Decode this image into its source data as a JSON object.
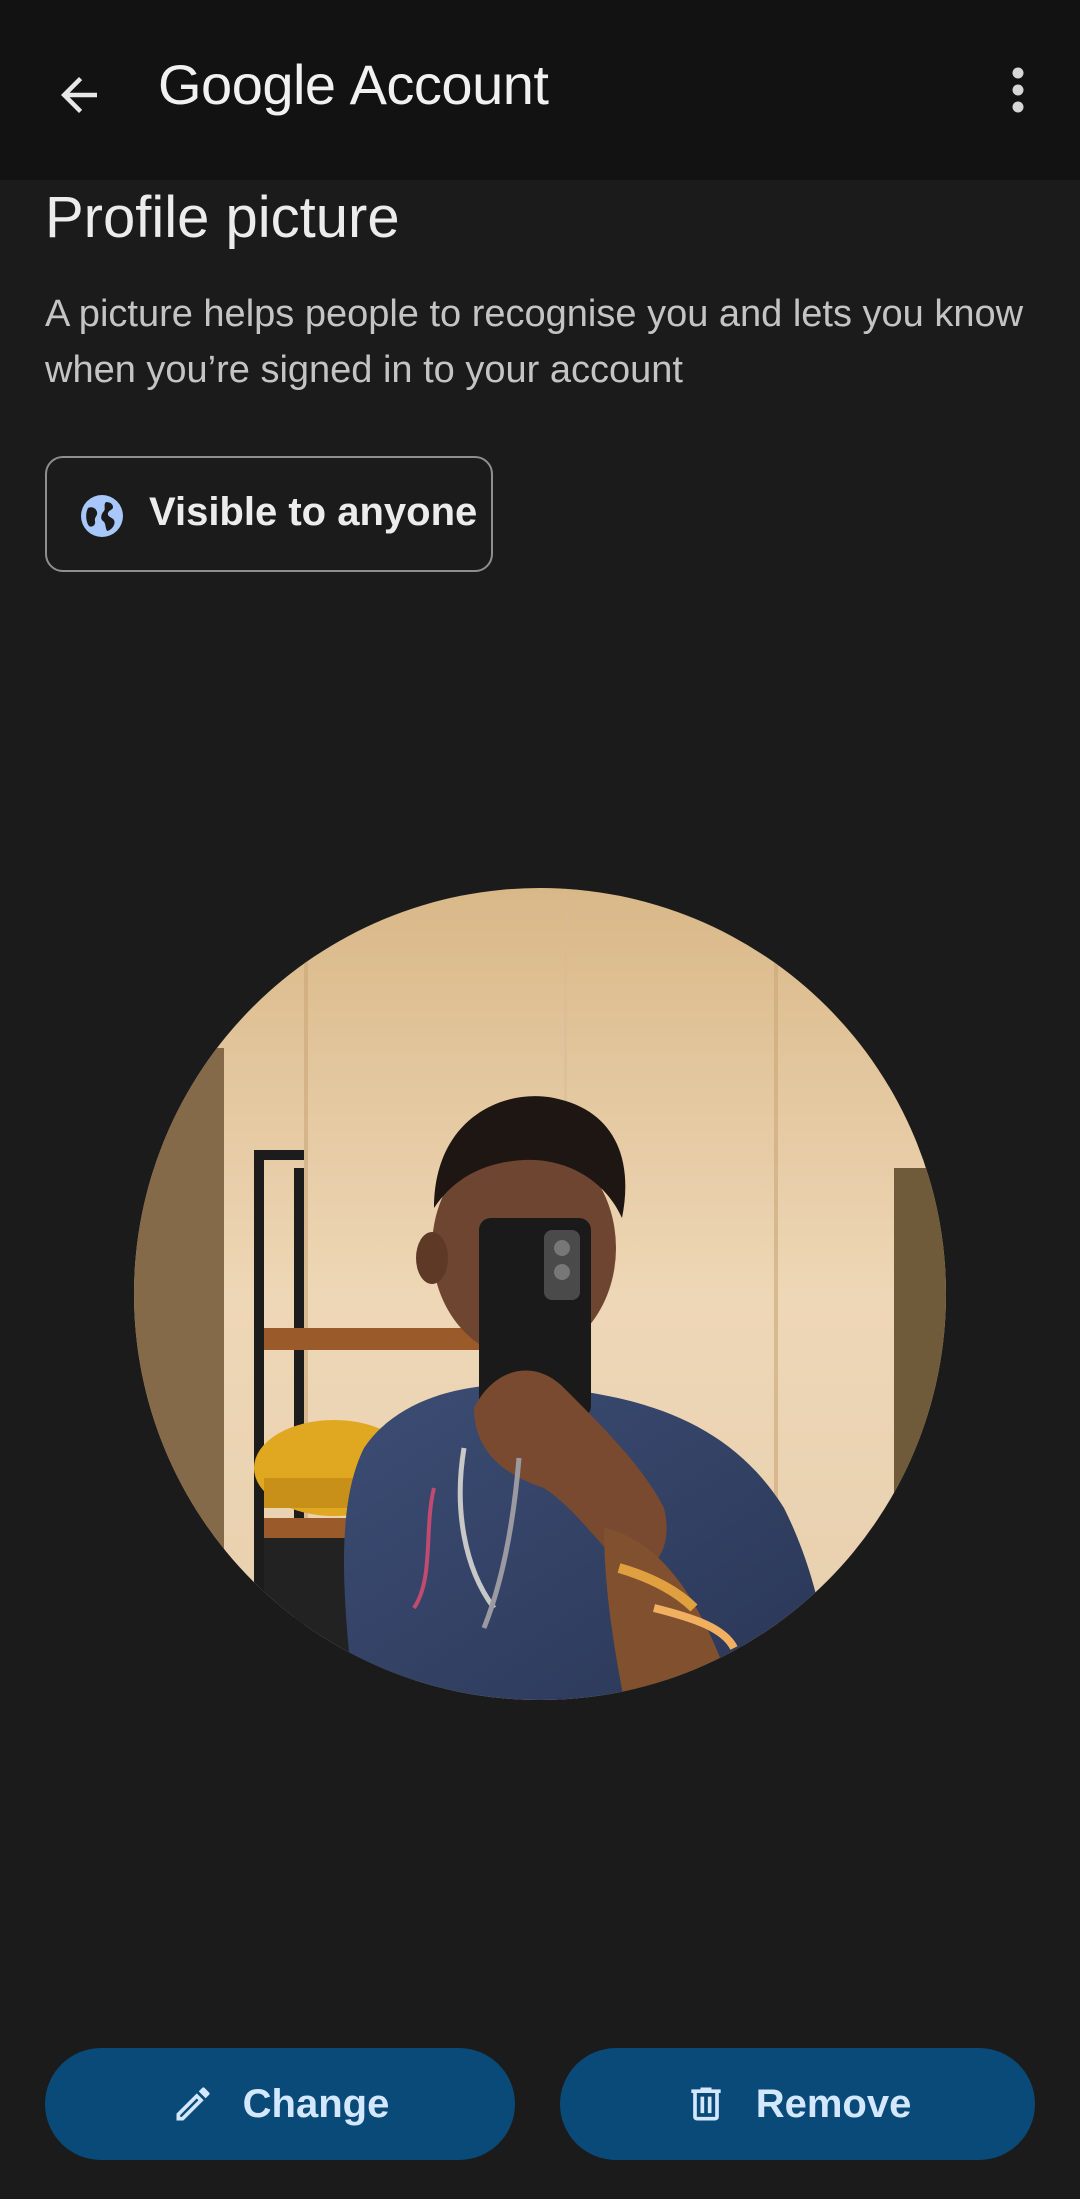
{
  "appbar": {
    "back_icon": "arrow-left-icon",
    "brand_google": "Google",
    "brand_account": "Account",
    "more_icon": "more-vert-icon"
  },
  "page": {
    "title": "Profile picture",
    "description": "A picture helps people to recognise you and lets you know when you’re signed in to your account"
  },
  "visibility": {
    "icon": "globe-icon",
    "label": "Visible to anyone"
  },
  "actions": {
    "change_label": "Change",
    "change_icon": "pencil-icon",
    "remove_label": "Remove",
    "remove_icon": "trash-icon"
  },
  "colors": {
    "background": "#1b1b1b",
    "appbar": "#121212",
    "button_fill": "#0a4a78",
    "button_text": "#d3e7ff",
    "globe": "#a8c7fa"
  }
}
